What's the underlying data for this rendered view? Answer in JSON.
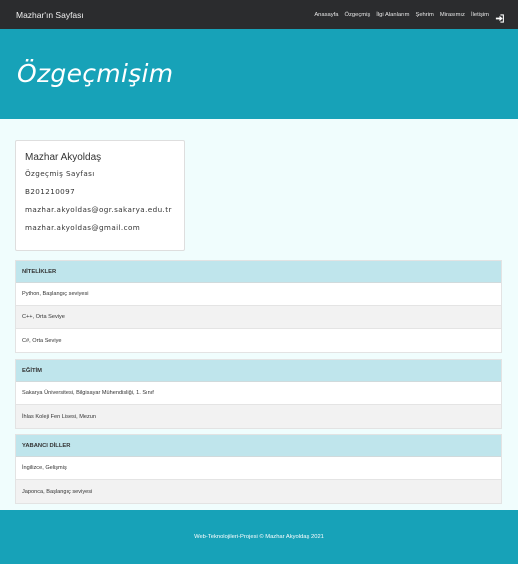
{
  "navbar": {
    "brand": "Mazhar'ın Sayfası",
    "menu": [
      "Anasayfa",
      "Özgeçmiş",
      "İlgi Alanlarım",
      "Şehrim",
      "Mirasımız",
      "İletişim"
    ],
    "login_icon": "sign-in-icon"
  },
  "hero": {
    "title": "Özgeçmişim"
  },
  "profile": {
    "name": "Mazhar Akyoldaş",
    "subtitle": "Özgeçmiş Sayfası",
    "student_no": "B201210097",
    "email_school": "mazhar.akyoldas@ogr.sakarya.edu.tr",
    "email_personal": "mazhar.akyoldas@gmail.com"
  },
  "sections": {
    "skills": {
      "title": "NİTELİKLER",
      "items": [
        "Python, Başlangıç seviyesi",
        "C++, Orta Seviye",
        "C#, Orta Seviye"
      ]
    },
    "education": {
      "title": "EĞİTİM",
      "items": [
        "Sakarya Üniversitesi, Bilgisayar Mühendisliği, 1. Sınıf",
        "İhlas Koleji Fen Lisesi, Mezun"
      ]
    },
    "languages": {
      "title": "YABANCI DİLLER",
      "items": [
        "İngilizce, Gelişmiş",
        "Japonca, Başlangıç seviyesi"
      ]
    }
  },
  "footer": {
    "text": "Web-Teknolojileri-Projesi © Mazhar Akyoldaş 2021"
  },
  "colors": {
    "navbar": "#2b2c2e",
    "accent": "#17a2b8",
    "section_header": "#bfe5ec",
    "background": "#f0fdfd"
  }
}
